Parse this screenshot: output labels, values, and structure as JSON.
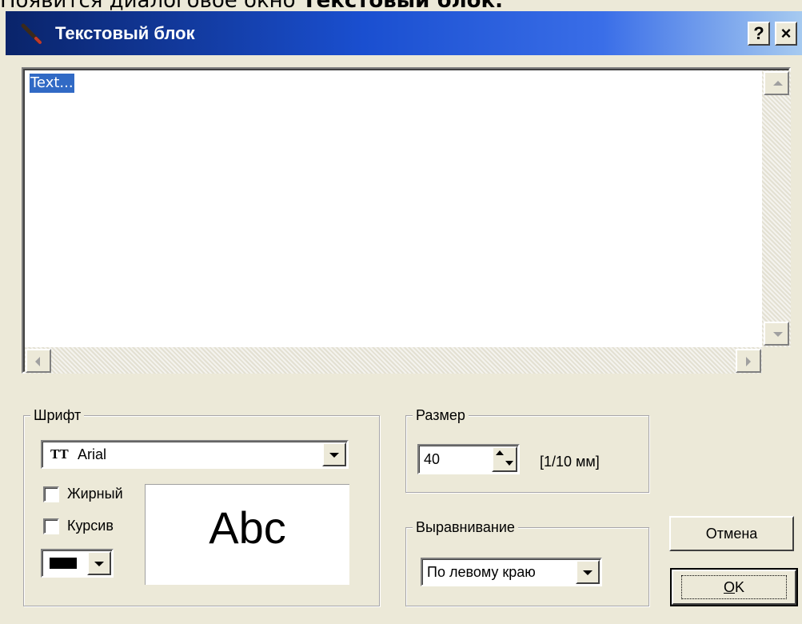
{
  "page": {
    "above_prefix": "Появится диалоговое окно ",
    "above_bold": "Текстовый блок."
  },
  "window": {
    "title": "Текстовый блок",
    "help_button": "?",
    "close_button": "×"
  },
  "editor": {
    "text": "Text..."
  },
  "font_group": {
    "label": "Шрифт",
    "font_name": "Arial",
    "font_icon": "truetype-font-icon",
    "bold_label": "Жирный",
    "bold_checked": false,
    "italic_label": "Курсив",
    "italic_checked": false,
    "color_value": "#000000",
    "preview_text": "Abc"
  },
  "size_group": {
    "label": "Размер",
    "value": "40",
    "unit": "[1/10 мм]"
  },
  "align_group": {
    "label": "Выравнивание",
    "selected": "По левому краю"
  },
  "buttons": {
    "cancel": "Отмена",
    "ok_prefix": "O",
    "ok_suffix": "K"
  },
  "colors": {
    "dialog_bg": "#ece9d8",
    "title_start": "#0a246a",
    "title_end": "#a6caf0",
    "selection": "#316ac5"
  }
}
